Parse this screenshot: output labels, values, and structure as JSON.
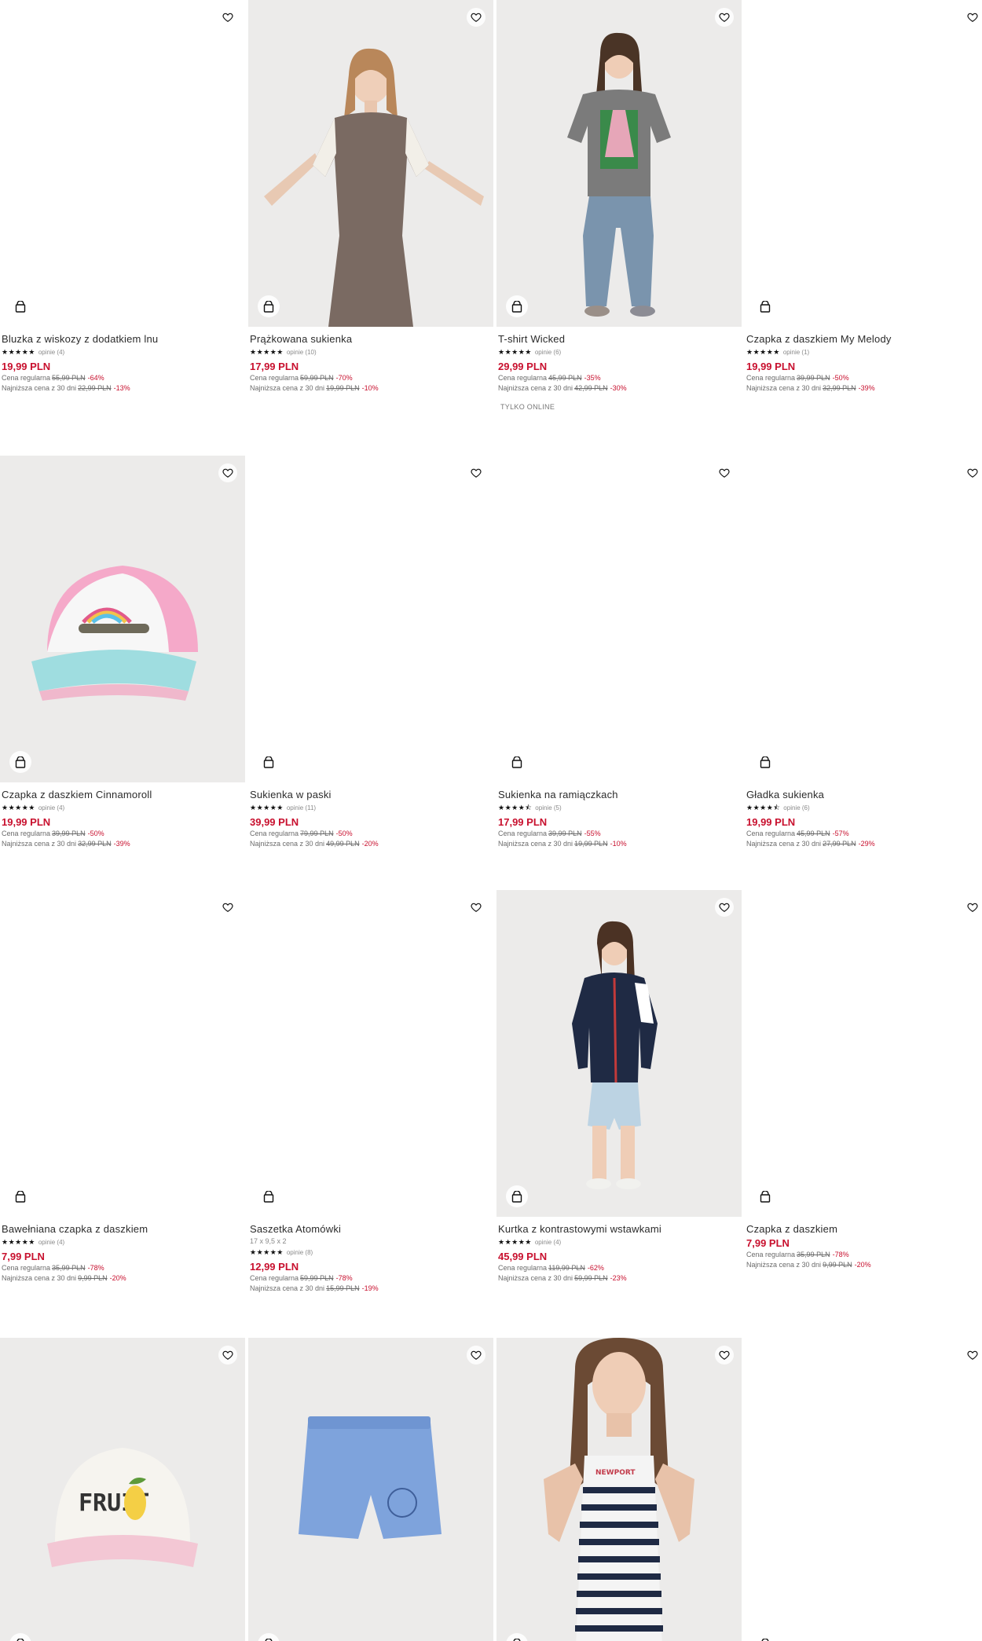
{
  "products": [
    {
      "name": "Bluzka z wiskozy z dodatkiem lnu",
      "stars": "★★★★★",
      "opinions": "opinie (4)",
      "price": "19,99 PLN",
      "regular_label": "Cena regularna",
      "regular_price": "55,99 PLN",
      "regular_discount": "-64%",
      "lowest_label": "Najniższa cena z 30 dni",
      "lowest_price": "22,99 PLN",
      "lowest_discount": "-13%"
    },
    {
      "name": "Prążkowana sukienka",
      "stars": "★★★★★",
      "opinions": "opinie (10)",
      "price": "17,99 PLN",
      "regular_label": "Cena regularna",
      "regular_price": "59,99 PLN",
      "regular_discount": "-70%",
      "lowest_label": "Najniższa cena z 30 dni",
      "lowest_price": "19,99 PLN",
      "lowest_discount": "-10%"
    },
    {
      "name": "T-shirt Wicked",
      "stars": "★★★★★",
      "opinions": "opinie (6)",
      "price": "29,99 PLN",
      "regular_label": "Cena regularna",
      "regular_price": "45,99 PLN",
      "regular_discount": "-35%",
      "lowest_label": "Najniższa cena z 30 dni",
      "lowest_price": "42,99 PLN",
      "lowest_discount": "-30%",
      "tag": "TYLKO ONLINE"
    },
    {
      "name": "Czapka z daszkiem My Melody",
      "stars": "★★★★★",
      "opinions": "opinie (1)",
      "price": "19,99 PLN",
      "regular_label": "Cena regularna",
      "regular_price": "39,99 PLN",
      "regular_discount": "-50%",
      "lowest_label": "Najniższa cena z 30 dni",
      "lowest_price": "32,99 PLN",
      "lowest_discount": "-39%"
    },
    {
      "name": "Czapka z daszkiem Cinnamoroll",
      "stars": "★★★★★",
      "opinions": "opinie (4)",
      "price": "19,99 PLN",
      "regular_label": "Cena regularna",
      "regular_price": "39,99 PLN",
      "regular_discount": "-50%",
      "lowest_label": "Najniższa cena z 30 dni",
      "lowest_price": "32,99 PLN",
      "lowest_discount": "-39%"
    },
    {
      "name": "Sukienka w paski",
      "stars": "★★★★★",
      "opinions": "opinie (11)",
      "price": "39,99 PLN",
      "regular_label": "Cena regularna",
      "regular_price": "79,99 PLN",
      "regular_discount": "-50%",
      "lowest_label": "Najniższa cena z 30 dni",
      "lowest_price": "49,99 PLN",
      "lowest_discount": "-20%"
    },
    {
      "name": "Sukienka na ramiączkach",
      "stars": "★★★★⯪",
      "opinions": "opinie (5)",
      "price": "17,99 PLN",
      "regular_label": "Cena regularna",
      "regular_price": "39,99 PLN",
      "regular_discount": "-55%",
      "lowest_label": "Najniższa cena z 30 dni",
      "lowest_price": "19,99 PLN",
      "lowest_discount": "-10%"
    },
    {
      "name": "Gładka sukienka",
      "stars": "★★★★⯪",
      "opinions": "opinie (6)",
      "price": "19,99 PLN",
      "regular_label": "Cena regularna",
      "regular_price": "45,99 PLN",
      "regular_discount": "-57%",
      "lowest_label": "Najniższa cena z 30 dni",
      "lowest_price": "27,99 PLN",
      "lowest_discount": "-29%"
    },
    {
      "name": "Bawełniana czapka z daszkiem",
      "stars": "★★★★★",
      "opinions": "opinie (4)",
      "price": "7,99 PLN",
      "regular_label": "Cena regularna",
      "regular_price": "35,99 PLN",
      "regular_discount": "-78%",
      "lowest_label": "Najniższa cena z 30 dni",
      "lowest_price": "9,99 PLN",
      "lowest_discount": "-20%"
    },
    {
      "name": "Saszetka Atomówki",
      "dims": "17 x 9,5 x 2",
      "stars": "★★★★★",
      "opinions": "opinie (8)",
      "price": "12,99 PLN",
      "regular_label": "Cena regularna",
      "regular_price": "59,99 PLN",
      "regular_discount": "-78%",
      "lowest_label": "Najniższa cena z 30 dni",
      "lowest_price": "15,99 PLN",
      "lowest_discount": "-19%"
    },
    {
      "name": "Kurtka z kontrastowymi wstawkami",
      "stars": "★★★★★",
      "opinions": "opinie (4)",
      "price": "45,99 PLN",
      "regular_label": "Cena regularna",
      "regular_price": "119,99 PLN",
      "regular_discount": "-62%",
      "lowest_label": "Najniższa cena z 30 dni",
      "lowest_price": "59,99 PLN",
      "lowest_discount": "-23%"
    },
    {
      "name": "Czapka z daszkiem",
      "price": "7,99 PLN",
      "regular_label": "Cena regularna",
      "regular_price": "35,99 PLN",
      "regular_discount": "-78%",
      "lowest_label": "Najniższa cena z 30 dni",
      "lowest_price": "9,99 PLN",
      "lowest_discount": "-20%"
    },
    {
      "logo_text": "FRUIT"
    },
    {},
    {
      "logo_text": "NEWPORT"
    },
    {}
  ],
  "icons": {
    "wishlist": "heart-icon",
    "add_to_cart": "shopping-bag-icon"
  },
  "colors": {
    "sale_price": "#c8102e",
    "text": "#2b2b2b",
    "muted": "#6b6b6b"
  }
}
